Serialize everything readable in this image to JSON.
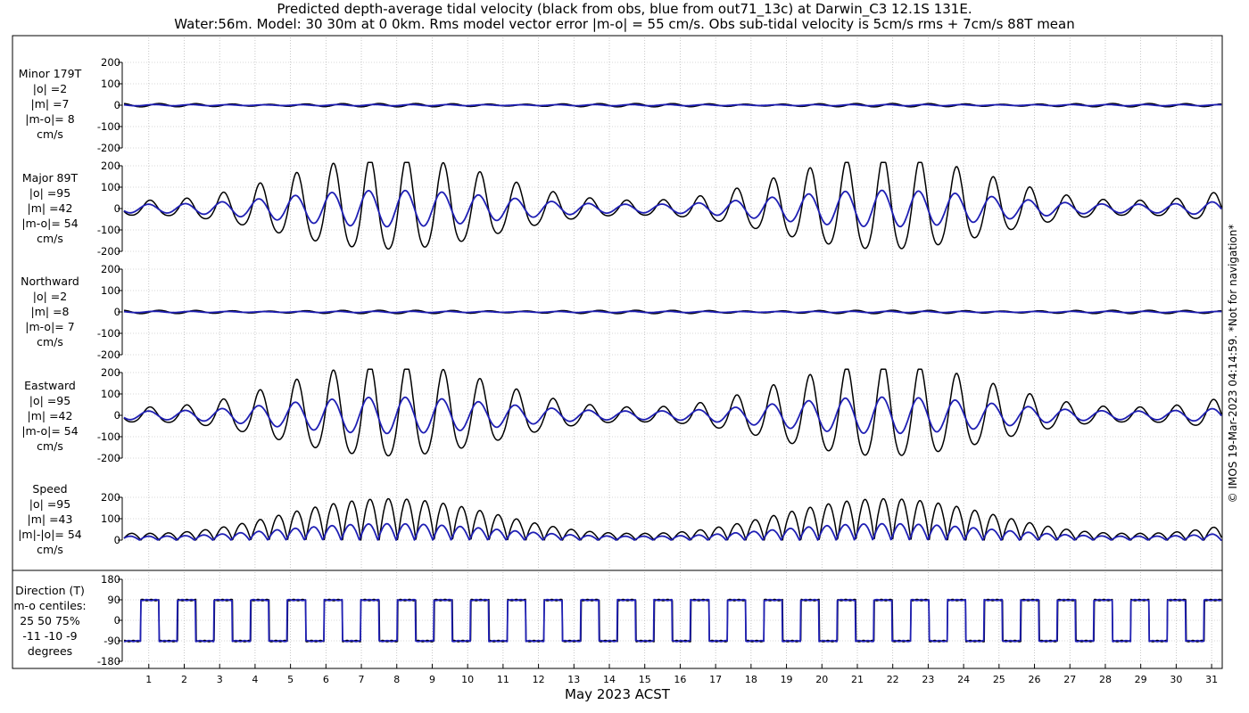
{
  "title_line1": "Predicted depth-average tidal velocity (black from obs, blue from out71_13c) at Darwin_C3 12.1S 131E.",
  "title_line2": "Water:56m. Model: 30 30m at 0 0km. Rms model vector error |m-o| = 55 cm/s. Obs sub-tidal velocity is 5cm/s rms + 7cm/s 88T mean",
  "watermark": "© IMOS 19-Mar-2023 04:14:59. *Not for navigation*",
  "colors": {
    "observed": "#000000",
    "model": "#1f1fb4",
    "grid": "#b0b0b0"
  },
  "chart_data": {
    "type": "line",
    "xlabel": "May 2023 ACST",
    "x_ticks": [
      "1",
      "2",
      "3",
      "4",
      "5",
      "6",
      "7",
      "8",
      "9",
      "10",
      "11",
      "12",
      "13",
      "14",
      "15",
      "16",
      "17",
      "18",
      "19",
      "20",
      "21",
      "22",
      "23",
      "24",
      "25",
      "26",
      "27",
      "28",
      "29",
      "30",
      "31"
    ],
    "xlim": [
      0.25,
      31.3
    ],
    "series_names": [
      "observed",
      "model"
    ],
    "panels": [
      {
        "id": "minor",
        "label": [
          "Minor 179T",
          "|o| =2",
          "|m| =7",
          "|m-o|= 8",
          "cm/s"
        ],
        "ylim": [
          -200,
          200
        ],
        "yticks": [
          "200",
          "100",
          "0",
          "-100",
          "-200"
        ],
        "series": [
          {
            "name": "observed",
            "amplitude": 8
          },
          {
            "name": "model",
            "amplitude": 3
          }
        ]
      },
      {
        "id": "major",
        "label": [
          "Major 89T",
          "|o| =95",
          "|m| =42",
          "|m-o|= 54",
          "cm/s"
        ],
        "ylim": [
          -200,
          200
        ],
        "yticks": [
          "200",
          "100",
          "0",
          "-100",
          "-200"
        ],
        "series": [
          {
            "name": "observed",
            "spring_peak": 215,
            "neap_trough": 35
          },
          {
            "name": "model",
            "spring_peak": 85,
            "neap_trough": 20
          }
        ]
      },
      {
        "id": "north",
        "label": [
          "Northward",
          "|o| =2",
          "|m| =8",
          "|m-o|= 7",
          "cm/s"
        ],
        "ylim": [
          -200,
          200
        ],
        "yticks": [
          "200",
          "100",
          "0",
          "-100",
          "-200"
        ],
        "series": [
          {
            "name": "observed",
            "amplitude": 8
          },
          {
            "name": "model",
            "amplitude": 3
          }
        ]
      },
      {
        "id": "east",
        "label": [
          "Eastward",
          "|o| =95",
          "|m| =42",
          "|m-o|= 54",
          "cm/s"
        ],
        "ylim": [
          -200,
          200
        ],
        "yticks": [
          "200",
          "100",
          "0",
          "-100",
          "-200"
        ],
        "series": [
          {
            "name": "observed",
            "spring_peak": 215,
            "neap_trough": 35
          },
          {
            "name": "model",
            "spring_peak": 85,
            "neap_trough": 20
          }
        ]
      },
      {
        "id": "speed",
        "label": [
          "Speed",
          "|o| =95",
          "|m| =43",
          "|m|-|o|= 54",
          "cm/s"
        ],
        "ylim": [
          0,
          200
        ],
        "yticks": [
          "200",
          "100",
          "0"
        ],
        "series": [
          {
            "name": "observed",
            "spring_peak": 215,
            "neap_trough": 35
          },
          {
            "name": "model",
            "spring_peak": 85,
            "neap_trough": 20
          }
        ]
      },
      {
        "id": "direction",
        "label": [
          "Direction (T)",
          "m-o centiles:",
          "25  50  75%",
          "-11 -10  -9",
          "degrees"
        ],
        "ylim": [
          -180,
          180
        ],
        "yticks": [
          "180",
          "90",
          "0",
          "-90",
          "-180"
        ],
        "series": [
          {
            "name": "observed",
            "levels": [
              89,
              -91
            ]
          },
          {
            "name": "model",
            "levels": [
              89,
              -91
            ]
          }
        ]
      }
    ]
  }
}
